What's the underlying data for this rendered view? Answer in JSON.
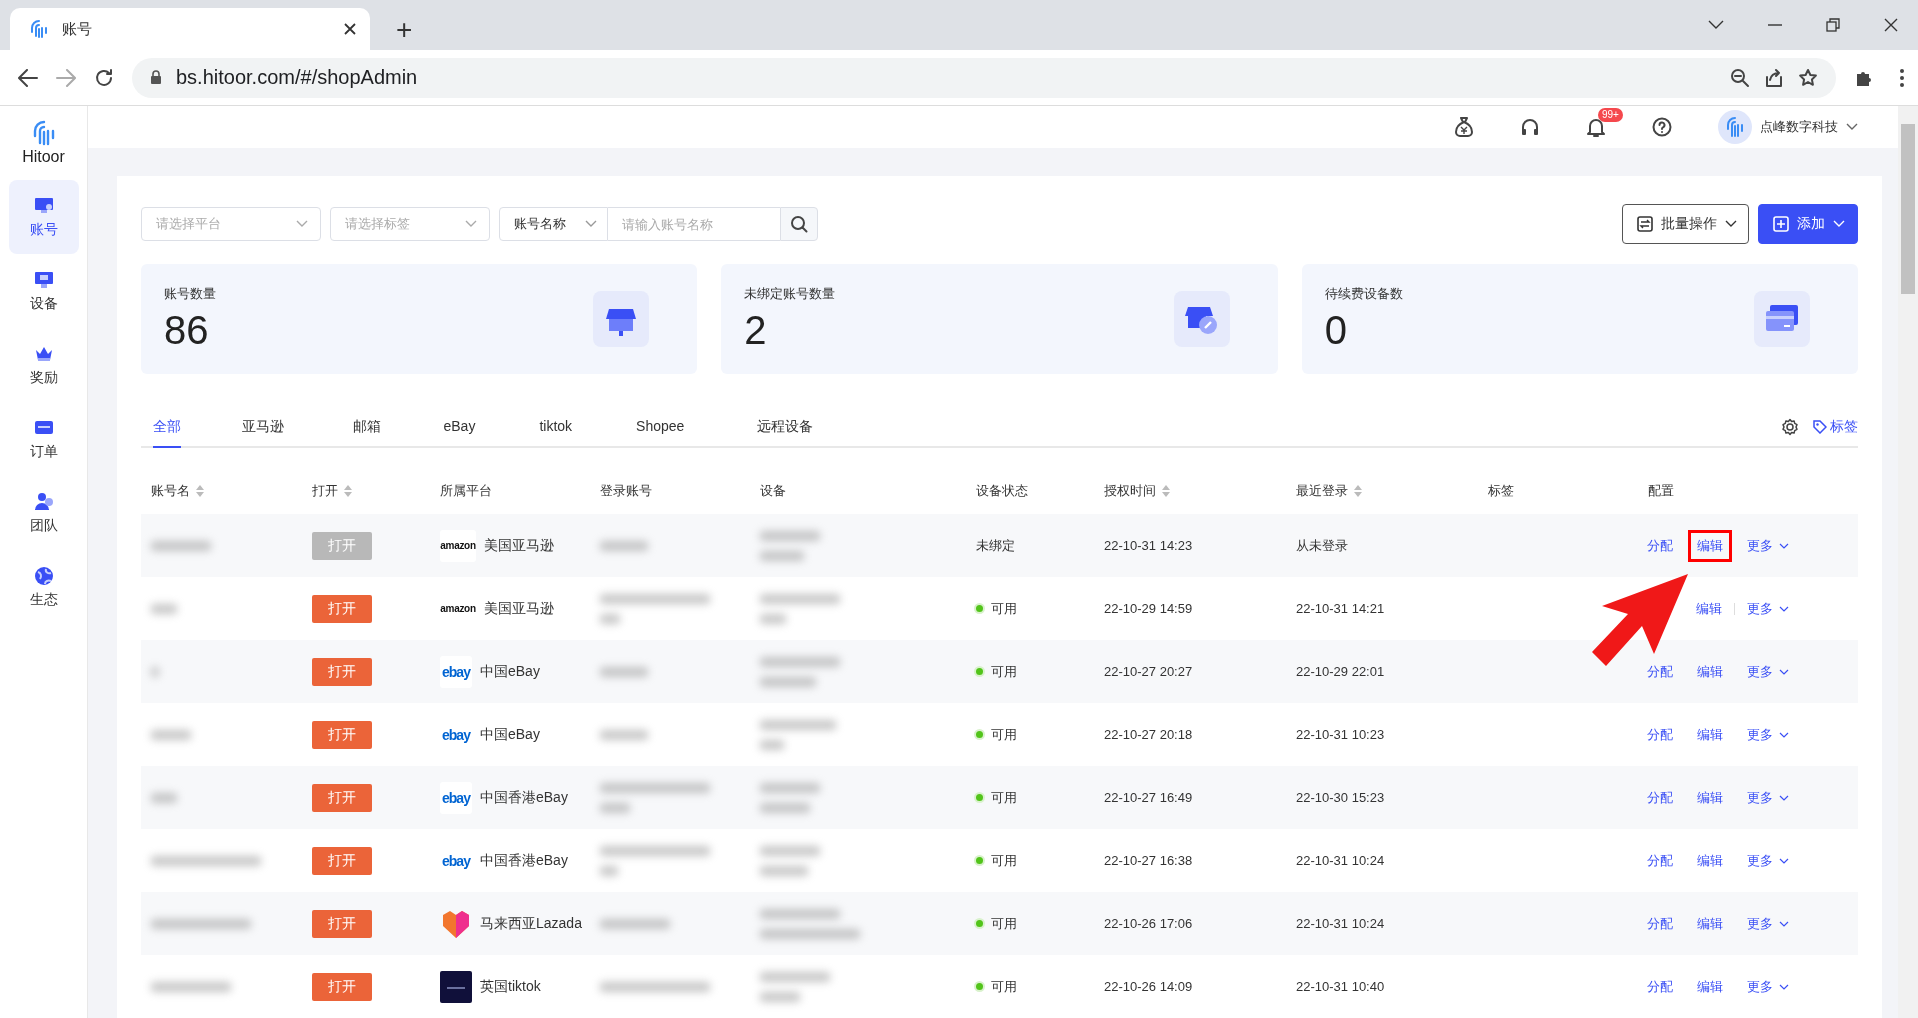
{
  "browser": {
    "tab_title": "账号",
    "new_tab": "+",
    "url": "bs.hitoor.com/#/shopAdmin"
  },
  "app": {
    "logo": "Hitoor",
    "sidebar": [
      {
        "label": "账号",
        "selected": true
      },
      {
        "label": "设备",
        "selected": false
      },
      {
        "label": "奖励",
        "selected": false
      },
      {
        "label": "订单",
        "selected": false
      },
      {
        "label": "团队",
        "selected": false
      },
      {
        "label": "生态",
        "selected": false
      }
    ],
    "header": {
      "notification_badge": "99+",
      "user": "点峰数字科技"
    }
  },
  "filters": {
    "platform": {
      "placeholder": "请选择平台"
    },
    "tag": {
      "placeholder": "请选择标签"
    },
    "search": {
      "field": "账号名称",
      "placeholder": "请输入账号名称"
    }
  },
  "actions": [
    {
      "label": "批量操作",
      "kind": "outline"
    },
    {
      "label": "添加",
      "kind": "primary"
    }
  ],
  "stats": [
    {
      "label": "账号数量",
      "value": "86"
    },
    {
      "label": "未绑定账号数量",
      "value": "2"
    },
    {
      "label": "待续费设备数",
      "value": "0"
    }
  ],
  "tabs": [
    {
      "label": "全部",
      "selected": true
    },
    {
      "label": "亚马逊",
      "selected": false
    },
    {
      "label": "邮箱",
      "selected": false
    },
    {
      "label": "eBay",
      "selected": false
    },
    {
      "label": "tiktok",
      "selected": false
    },
    {
      "label": "Shopee",
      "selected": false
    },
    {
      "label": "远程设备",
      "selected": false
    }
  ],
  "tag_link": "标签",
  "table": {
    "columns": [
      {
        "label": "账号名",
        "sortable": true
      },
      {
        "label": "打开",
        "sortable": true
      },
      {
        "label": "所属平台",
        "sortable": false
      },
      {
        "label": "登录账号",
        "sortable": false
      },
      {
        "label": "设备",
        "sortable": false
      },
      {
        "label": "设备状态",
        "sortable": false
      },
      {
        "label": "授权时间",
        "sortable": true
      },
      {
        "label": "最近登录",
        "sortable": true
      },
      {
        "label": "标签",
        "sortable": false
      },
      {
        "label": "配置",
        "sortable": false
      }
    ],
    "rows": [
      {
        "open": "打开",
        "open_enabled": false,
        "kind": "wordmark",
        "platform_logo": "amazon",
        "platform": "美国亚马逊",
        "status": "未绑定",
        "available": false,
        "auth_time": "22-10-31 14:23",
        "last_login": "从未登录",
        "actions": [
          {
            "label": "分配",
            "highlighted": false
          },
          {
            "label": "编辑",
            "highlighted": true
          },
          {
            "label": "更多",
            "highlighted": false
          }
        ]
      },
      {
        "open": "打开",
        "open_enabled": true,
        "kind": "wordmark",
        "platform_logo": "amazon",
        "platform": "美国亚马逊",
        "status": "可用",
        "available": true,
        "auth_time": "22-10-29 14:59",
        "last_login": "22-10-31 14:21",
        "actions": [
          {
            "label": "编辑",
            "highlighted": false
          },
          {
            "label": "更多",
            "highlighted": false
          }
        ]
      },
      {
        "open": "打开",
        "open_enabled": true,
        "kind": "multicolor-wordmark",
        "platform_logo": "ebay",
        "platform": "中国eBay",
        "status": "可用",
        "available": true,
        "auth_time": "22-10-27 20:27",
        "last_login": "22-10-29 22:01",
        "actions": [
          {
            "label": "分配",
            "highlighted": false
          },
          {
            "label": "编辑",
            "highlighted": false
          },
          {
            "label": "更多",
            "highlighted": false
          }
        ]
      },
      {
        "open": "打开",
        "open_enabled": true,
        "kind": "multicolor-wordmark",
        "platform_logo": "ebay",
        "platform": "中国eBay",
        "status": "可用",
        "available": true,
        "auth_time": "22-10-27 20:18",
        "last_login": "22-10-31 10:23",
        "actions": [
          {
            "label": "分配",
            "highlighted": false
          },
          {
            "label": "编辑",
            "highlighted": false
          },
          {
            "label": "更多",
            "highlighted": false
          }
        ]
      },
      {
        "open": "打开",
        "open_enabled": true,
        "kind": "multicolor-wordmark",
        "platform_logo": "ebay",
        "platform": "中国香港eBay",
        "status": "可用",
        "available": true,
        "auth_time": "22-10-27 16:49",
        "last_login": "22-10-30 15:23",
        "actions": [
          {
            "label": "分配",
            "highlighted": false
          },
          {
            "label": "编辑",
            "highlighted": false
          },
          {
            "label": "更多",
            "highlighted": false
          }
        ]
      },
      {
        "open": "打开",
        "open_enabled": true,
        "kind": "multicolor-wordmark",
        "platform_logo": "ebay",
        "platform": "中国香港eBay",
        "status": "可用",
        "available": true,
        "auth_time": "22-10-27 16:38",
        "last_login": "22-10-31 10:24",
        "actions": [
          {
            "label": "分配",
            "highlighted": false
          },
          {
            "label": "编辑",
            "highlighted": false
          },
          {
            "label": "更多",
            "highlighted": false
          }
        ]
      },
      {
        "open": "打开",
        "open_enabled": true,
        "kind": "heart",
        "platform": "马来西亚Lazada",
        "status": "可用",
        "available": true,
        "auth_time": "22-10-26 17:06",
        "last_login": "22-10-31 10:24",
        "actions": [
          {
            "label": "分配",
            "highlighted": false
          },
          {
            "label": "编辑",
            "highlighted": false
          },
          {
            "label": "更多",
            "highlighted": false
          }
        ]
      },
      {
        "open": "打开",
        "open_enabled": true,
        "kind": "square",
        "platform": "英国tiktok",
        "status": "可用",
        "available": true,
        "auth_time": "22-10-26 14:09",
        "last_login": "22-10-31 10:40",
        "actions": [
          {
            "label": "分配",
            "highlighted": false
          },
          {
            "label": "编辑",
            "highlighted": false
          },
          {
            "label": "更多",
            "highlighted": false
          }
        ]
      }
    ]
  }
}
